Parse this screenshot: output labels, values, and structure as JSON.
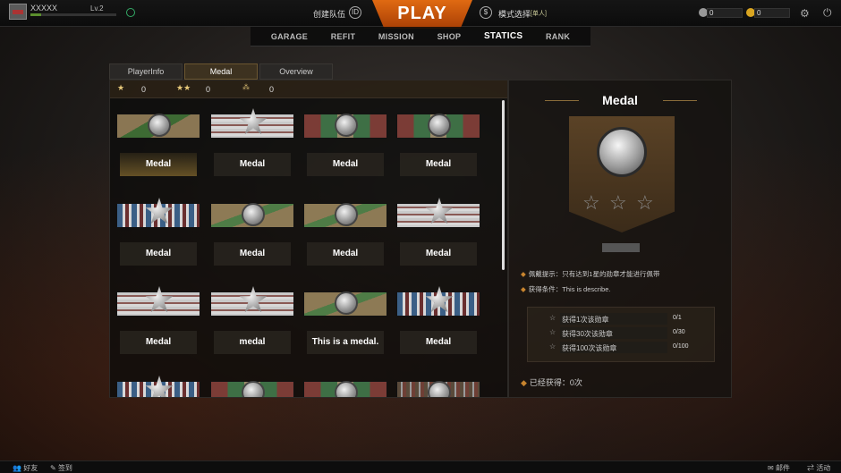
{
  "player": {
    "name": "XXXXX",
    "level": "Lv.2",
    "xp_fraction": 0.12
  },
  "top": {
    "create_team": "创建队伍",
    "team_icon": "ID",
    "play": "PLAY",
    "mode_select": "模式选择",
    "mode_tag": "[单人]",
    "mode_icon": "$",
    "currency1": "0",
    "currency2": "0"
  },
  "nav": [
    "GARAGE",
    "REFIT",
    "MISSION",
    "SHOP",
    "STATICS",
    "RANK"
  ],
  "nav_active": "STATICS",
  "tabs": [
    "PlayerInfo",
    "Medal",
    "Overview"
  ],
  "active_tab": "Medal",
  "star_counts": {
    "one": "0",
    "two": "0",
    "three": "0"
  },
  "medals": [
    {
      "label": "Medal",
      "selected": true
    },
    {
      "label": "Medal"
    },
    {
      "label": "Medal"
    },
    {
      "label": "Medal"
    },
    {
      "label": "Medal"
    },
    {
      "label": "Medal"
    },
    {
      "label": "Medal"
    },
    {
      "label": "Medal"
    },
    {
      "label": "Medal"
    },
    {
      "label": "medal"
    },
    {
      "label": "This is a medal."
    },
    {
      "label": "Medal"
    }
  ],
  "detail": {
    "title": "Medal",
    "hint": "佩戴提示：只有达到1星的勋章才能进行佩带",
    "condition": "获得条件：This is describe.",
    "tasks": [
      {
        "label": "获得1次该勋章",
        "value": "0/1"
      },
      {
        "label": "获得30次该勋章",
        "value": "0/30"
      },
      {
        "label": "获得100次该勋章",
        "value": "0/100"
      }
    ],
    "obtained": "已经获得：0次"
  },
  "bottom": {
    "friends": "好友",
    "checkin": "签到",
    "mail": "邮件",
    "events": "活动"
  },
  "colors": {
    "accent": "#c8842e",
    "play": "#e06a12"
  }
}
